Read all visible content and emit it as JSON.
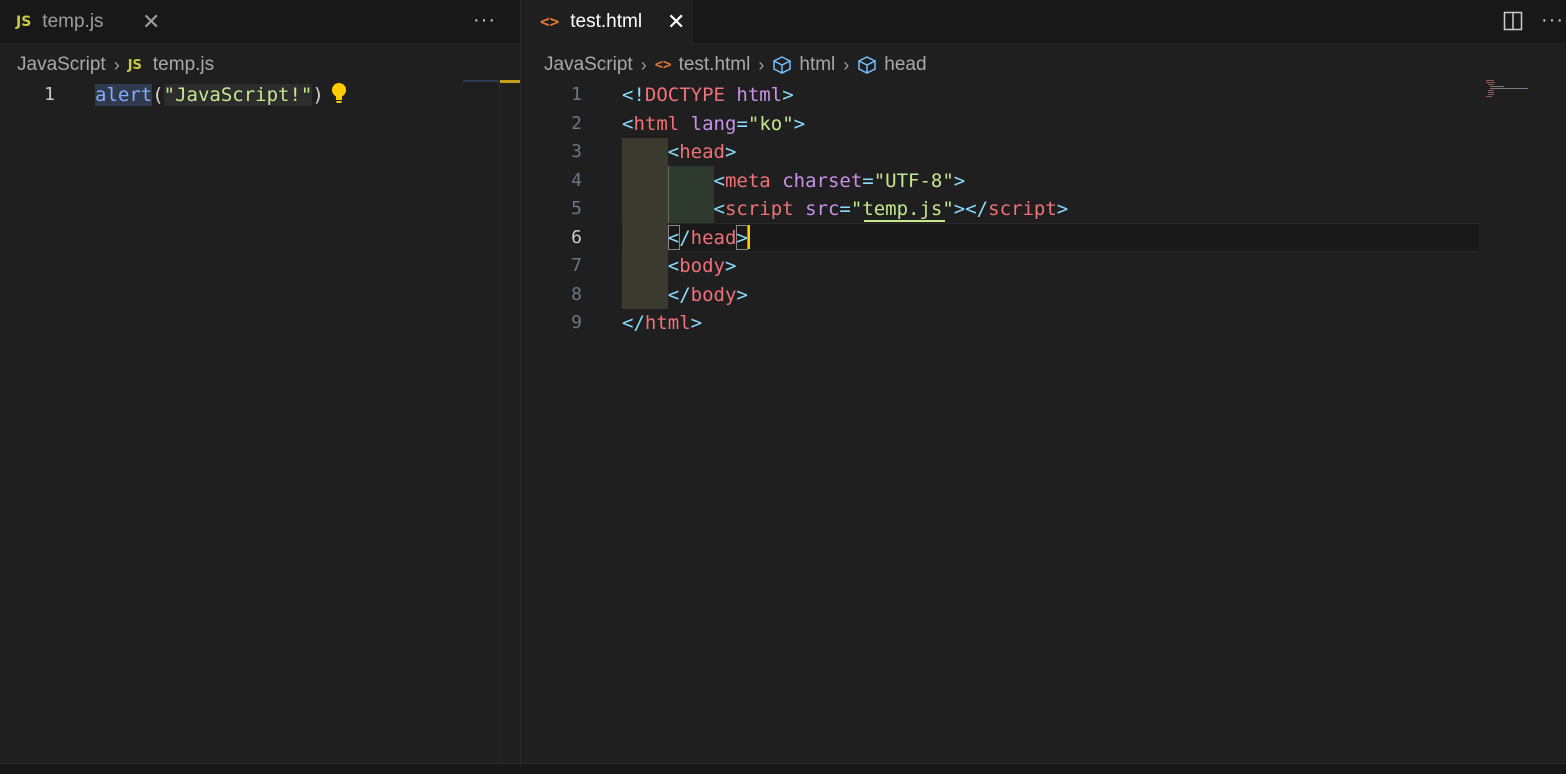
{
  "left_editor": {
    "tab": {
      "badge": "JS",
      "label": "temp.js",
      "close": "✕"
    },
    "more": "···",
    "breadcrumb": {
      "folder": "JavaScript",
      "file_badge": "JS",
      "file": "temp.js"
    },
    "lines": [
      {
        "number": "1"
      }
    ],
    "code": {
      "fn": "alert",
      "open": "(",
      "str": "\"JavaScript!\"",
      "close": ")"
    },
    "lightbulb_icon": "lightbulb-icon"
  },
  "right_editor": {
    "tab": {
      "badge": "<>",
      "label": "test.html",
      "close": "✕"
    },
    "split_icon": "split-editor-icon",
    "more": "···",
    "breadcrumb": {
      "folder": "JavaScript",
      "file_badge": "<>",
      "file": "test.html",
      "sym1": "html",
      "sym2": "head"
    },
    "line_numbers": [
      "1",
      "2",
      "3",
      "4",
      "5",
      "6",
      "7",
      "8",
      "9"
    ],
    "current_line": "6"
  },
  "colors": {
    "background": "#1f1f1f",
    "tabbar": "#181818",
    "accent_js": "#cbcb41",
    "accent_html": "#e37933"
  }
}
